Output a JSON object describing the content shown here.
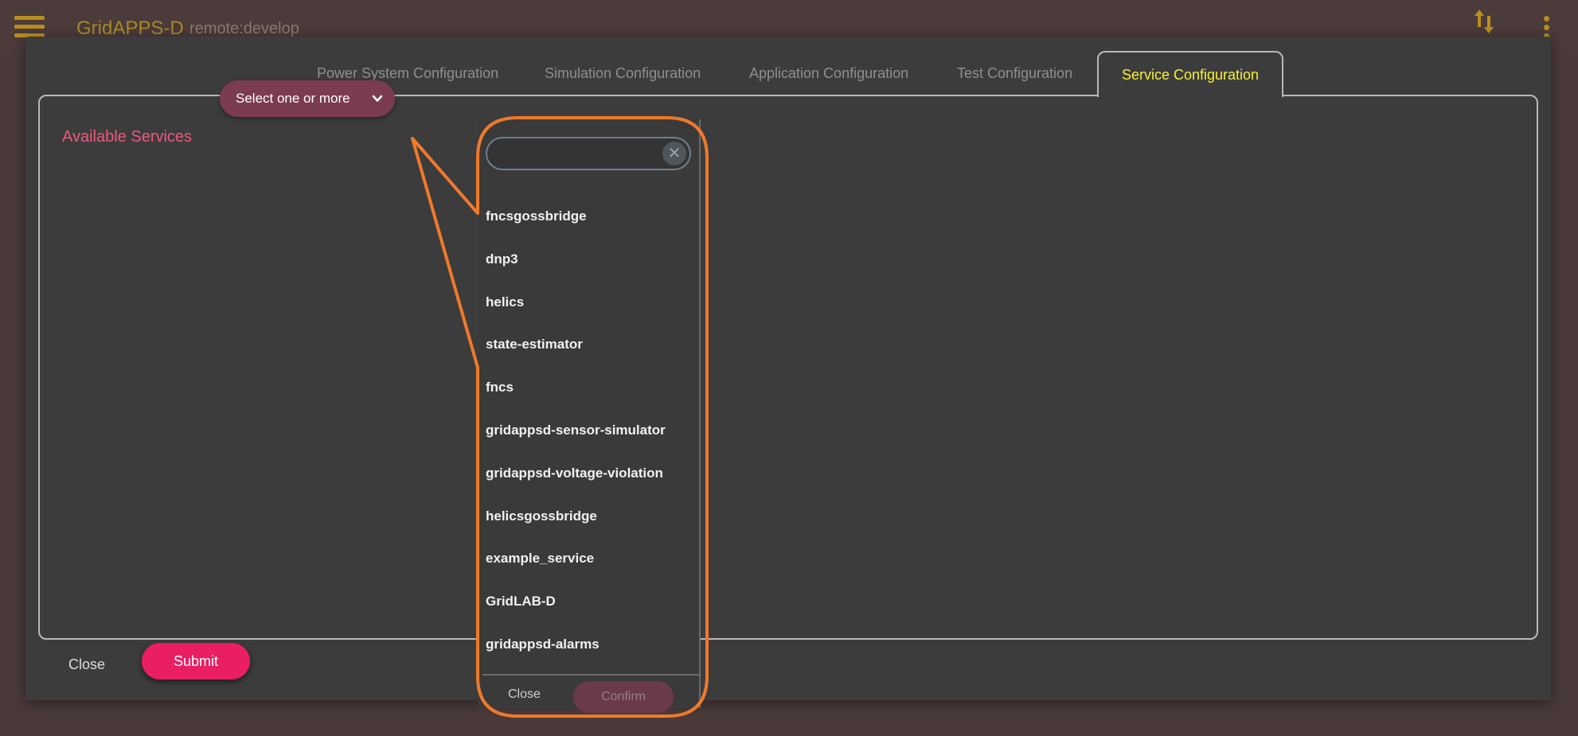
{
  "app": {
    "title": "GridAPPS-D",
    "environment": "remote:develop"
  },
  "tabs": [
    {
      "label": "Power System Configuration",
      "active": false
    },
    {
      "label": "Simulation Configuration",
      "active": false
    },
    {
      "label": "Application Configuration",
      "active": false
    },
    {
      "label": "Test Configuration",
      "active": false
    },
    {
      "label": "Service Configuration",
      "active": true
    }
  ],
  "service_config": {
    "label": "Available Services",
    "select_placeholder": "Select one or more"
  },
  "dropdown": {
    "search_value": "",
    "clear_glyph": "✕",
    "options": [
      "fncsgossbridge",
      "dnp3",
      "helics",
      "state-estimator",
      "fncs",
      "gridappsd-sensor-simulator",
      "gridappsd-voltage-violation",
      "helicsgossbridge",
      "example_service",
      "GridLAB-D",
      "gridappsd-alarms"
    ],
    "close_label": "Close",
    "confirm_label": "Confirm"
  },
  "footer": {
    "close_label": "Close",
    "submit_label": "Submit"
  },
  "colors": {
    "accent_active_tab": "#f7ef3a",
    "label_pink": "#f0567d",
    "submit": "#e91e63",
    "highlight_annotation": "#ef7a2b"
  }
}
